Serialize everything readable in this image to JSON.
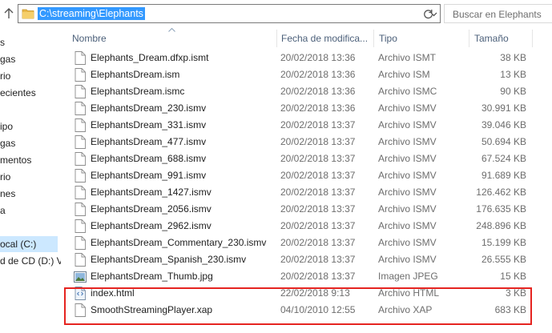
{
  "address": {
    "path": "C:\\streaming\\Elephants"
  },
  "search": {
    "placeholder": "Buscar en Elephants"
  },
  "nav": {
    "items": [
      {
        "label": "s"
      },
      {
        "label": "gas"
      },
      {
        "label": "rio"
      },
      {
        "label": "ecientes"
      },
      {
        "label": ""
      },
      {
        "label": "ipo"
      },
      {
        "label": "gas"
      },
      {
        "label": "mentos"
      },
      {
        "label": "rio"
      },
      {
        "label": "nes"
      },
      {
        "label": "a"
      },
      {
        "label": ""
      },
      {
        "label": "ocal (C:)"
      },
      {
        "label": "d de CD (D:) V"
      }
    ]
  },
  "columns": {
    "name": "Nombre",
    "date": "Fecha de modifica...",
    "type": "Tipo",
    "size": "Tamaño"
  },
  "files": [
    {
      "name": "Elephants_Dream.dfxp.ismt",
      "date": "20/02/2018 13:36",
      "type": "Archivo ISMT",
      "size": "38 KB",
      "icon": "document-icon"
    },
    {
      "name": "ElephantsDream.ism",
      "date": "20/02/2018 13:36",
      "type": "Archivo ISM",
      "size": "13 KB",
      "icon": "document-icon"
    },
    {
      "name": "ElephantsDream.ismc",
      "date": "20/02/2018 13:36",
      "type": "Archivo ISMC",
      "size": "90 KB",
      "icon": "document-icon"
    },
    {
      "name": "ElephantsDream_230.ismv",
      "date": "20/02/2018 13:36",
      "type": "Archivo ISMV",
      "size": "30.991 KB",
      "icon": "document-icon"
    },
    {
      "name": "ElephantsDream_331.ismv",
      "date": "20/02/2018 13:37",
      "type": "Archivo ISMV",
      "size": "39.046 KB",
      "icon": "document-icon"
    },
    {
      "name": "ElephantsDream_477.ismv",
      "date": "20/02/2018 13:37",
      "type": "Archivo ISMV",
      "size": "50.694 KB",
      "icon": "document-icon"
    },
    {
      "name": "ElephantsDream_688.ismv",
      "date": "20/02/2018 13:37",
      "type": "Archivo ISMV",
      "size": "67.524 KB",
      "icon": "document-icon"
    },
    {
      "name": "ElephantsDream_991.ismv",
      "date": "20/02/2018 13:37",
      "type": "Archivo ISMV",
      "size": "91.689 KB",
      "icon": "document-icon"
    },
    {
      "name": "ElephantsDream_1427.ismv",
      "date": "20/02/2018 13:37",
      "type": "Archivo ISMV",
      "size": "126.462 KB",
      "icon": "document-icon"
    },
    {
      "name": "ElephantsDream_2056.ismv",
      "date": "20/02/2018 13:37",
      "type": "Archivo ISMV",
      "size": "176.635 KB",
      "icon": "document-icon"
    },
    {
      "name": "ElephantsDream_2962.ismv",
      "date": "20/02/2018 13:37",
      "type": "Archivo ISMV",
      "size": "248.896 KB",
      "icon": "document-icon"
    },
    {
      "name": "ElephantsDream_Commentary_230.ismv",
      "date": "20/02/2018 13:37",
      "type": "Archivo ISMV",
      "size": "15.199 KB",
      "icon": "document-icon"
    },
    {
      "name": "ElephantsDream_Spanish_230.ismv",
      "date": "20/02/2018 13:37",
      "type": "Archivo ISMV",
      "size": "26.555 KB",
      "icon": "document-icon"
    },
    {
      "name": "ElephantsDream_Thumb.jpg",
      "date": "20/02/2018 13:37",
      "type": "Imagen JPEG",
      "size": "15 KB",
      "icon": "image-icon"
    },
    {
      "name": "index.html",
      "date": "22/02/2018 9:13",
      "type": "Archivo HTML",
      "size": "3 KB",
      "icon": "html-file-icon"
    },
    {
      "name": "SmoothStreamingPlayer.xap",
      "date": "04/10/2010 12:55",
      "type": "Archivo XAP",
      "size": "683 KB",
      "icon": "document-icon"
    }
  ],
  "colors": {
    "selection": "#3399ff",
    "highlight_box": "#e52420",
    "nav_selected": "#cce8ff"
  }
}
